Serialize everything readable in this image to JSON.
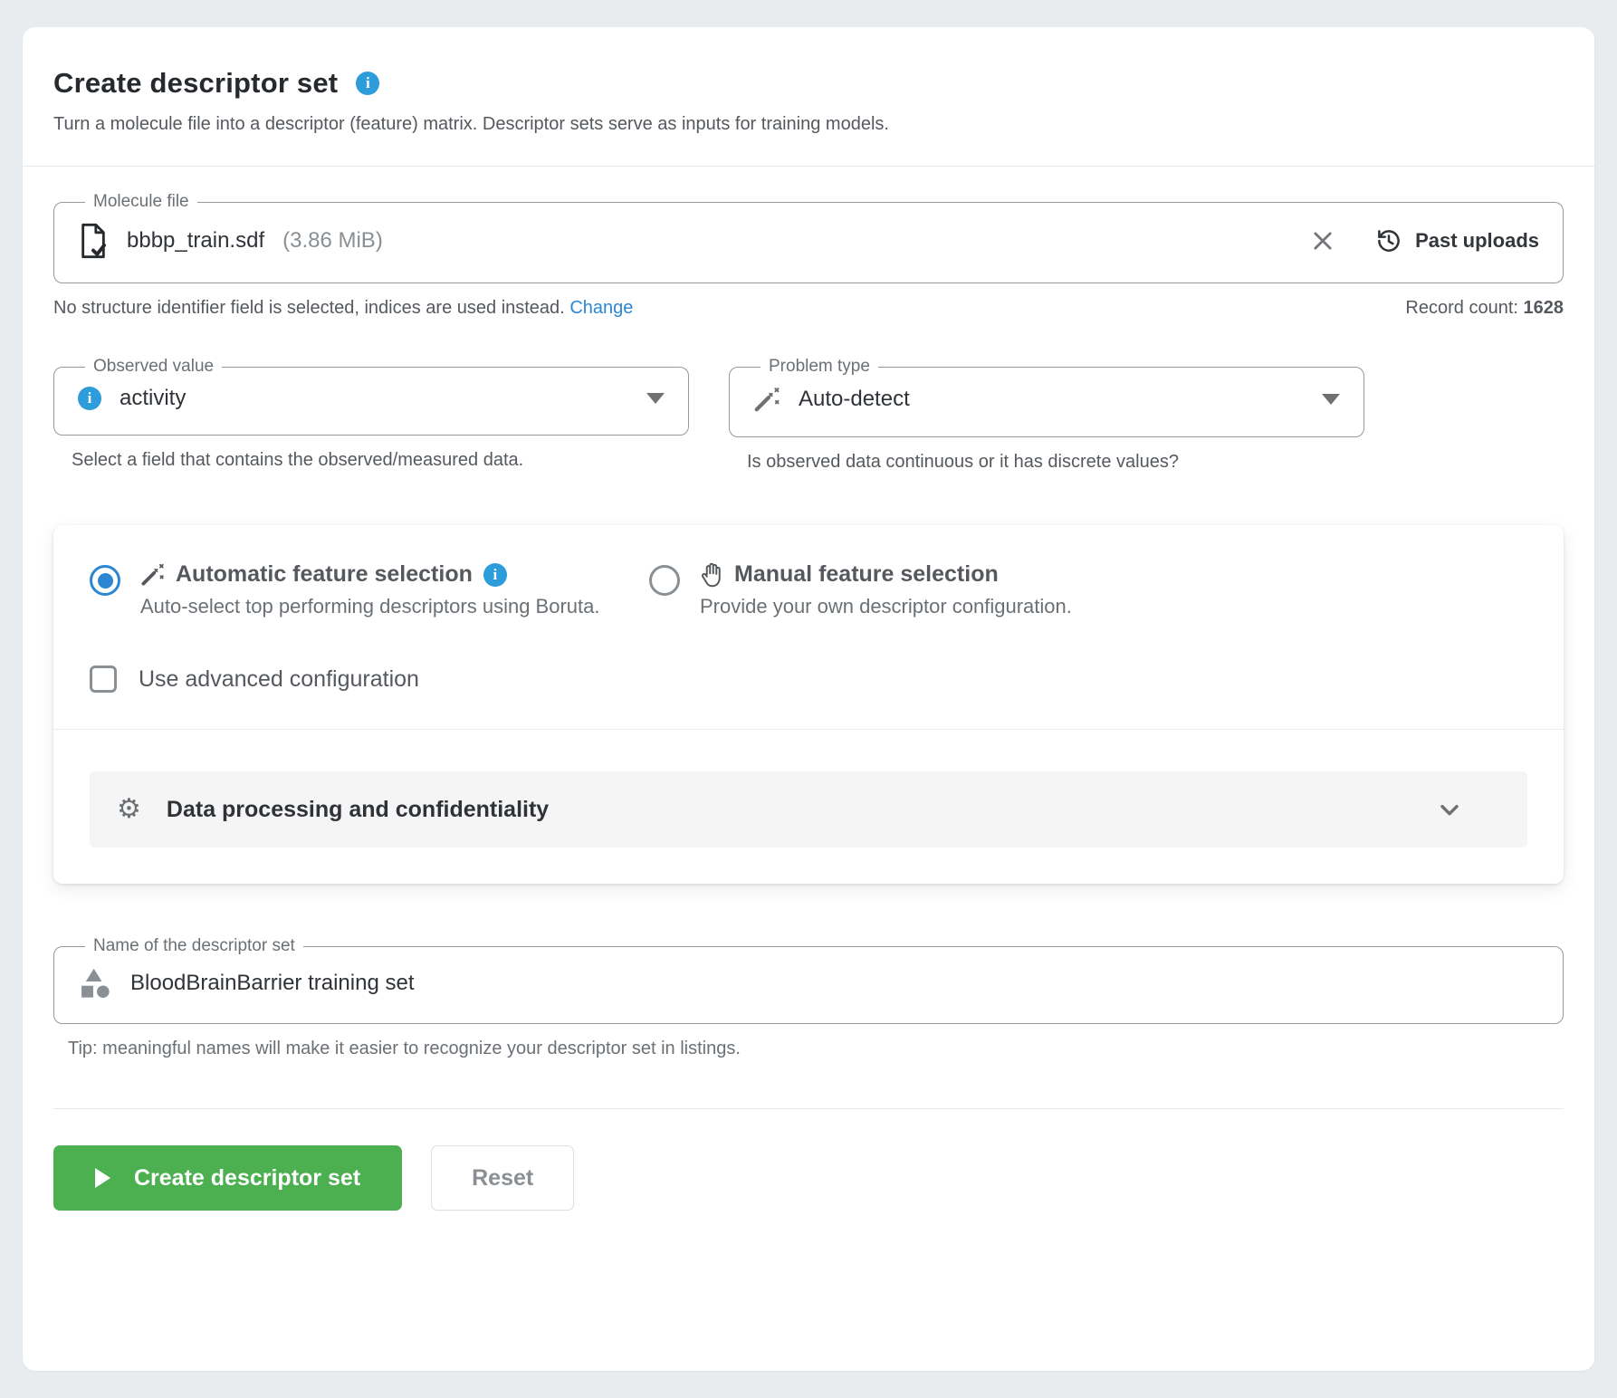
{
  "page": {
    "title": "Create descriptor set",
    "subtitle": "Turn a molecule file into a descriptor (feature) matrix. Descriptor sets serve as inputs for training models."
  },
  "molecule_file": {
    "label": "Molecule file",
    "file_name": "bbbp_train.sdf",
    "file_size": "(3.86 MiB)",
    "past_uploads_label": "Past uploads",
    "identifier_note": "No structure identifier field is selected, indices are used instead.",
    "change_link": "Change",
    "record_count_label": "Record count:",
    "record_count_value": "1628"
  },
  "observed_value": {
    "label": "Observed value",
    "value": "activity",
    "helper": "Select a field that contains the observed/measured data."
  },
  "problem_type": {
    "label": "Problem type",
    "value": "Auto-detect",
    "helper": "Is observed data continuous or it has discrete values?"
  },
  "feature_selection": {
    "automatic": {
      "label": "Automatic feature selection",
      "description": "Auto-select top performing descriptors using Boruta.",
      "selected": true
    },
    "manual": {
      "label": "Manual feature selection",
      "description": "Provide your own descriptor configuration.",
      "selected": false
    },
    "advanced_checkbox_label": "Use advanced configuration",
    "advanced_checked": false,
    "data_processing_label": "Data processing and confidentiality"
  },
  "name_field": {
    "label": "Name of the descriptor set",
    "value": "BloodBrainBarrier training set",
    "tip": "Tip: meaningful names will make it easier to recognize your descriptor set in listings."
  },
  "actions": {
    "create_label": "Create descriptor set",
    "reset_label": "Reset"
  },
  "colors": {
    "accent_blue": "#2D9CDB",
    "link_blue": "#2B87D3",
    "radio_blue": "#2B87D3",
    "button_green": "#4CAF50",
    "page_background": "#E8ECEF"
  },
  "icons": {
    "info": "info-icon (blue circle, white i)",
    "file_check": "document with check mark",
    "clear": "✕",
    "history": "clock with counterclockwise arrow",
    "dropdown": "▾",
    "wand": "magic wand with sparkles",
    "hand": "raised hand",
    "gear": "⚙",
    "chevron_down": "˅",
    "shapes": "triangle, square and circle",
    "play": "▶"
  }
}
